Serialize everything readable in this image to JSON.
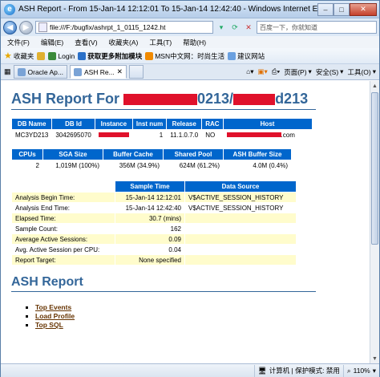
{
  "window": {
    "title": "ASH Report - From 15-Jan-14 12:12:01 To 15-Jan-14 12:42:40 - Windows Internet Explorer",
    "min": "–",
    "max": "□",
    "close": "✕"
  },
  "address": {
    "url": "file:///F:/bugfix/ashrpt_1_0115_1242.ht",
    "search_placeholder": "百度一下，你就知道"
  },
  "menu": [
    "文件(F)",
    "编辑(E)",
    "查看(V)",
    "收藏夹(A)",
    "工具(T)",
    "帮助(H)"
  ],
  "favorites": {
    "label": "收藏夹",
    "items": [
      "Login",
      "获取更多附加模块",
      "MSN中文网：时尚生活",
      "建议网站"
    ]
  },
  "tabs": [
    {
      "label": "Oracle Ap..."
    },
    {
      "label": "ASH Re..."
    }
  ],
  "commands": [
    "页面(P)",
    "安全(S)",
    "工具(O)"
  ],
  "report": {
    "title_prefix": "ASH Report For",
    "title_mid": "0213/",
    "title_suffix": "d213",
    "db_table": {
      "headers": [
        "DB Name",
        "DB Id",
        "Instance",
        "Inst num",
        "Release",
        "RAC",
        "Host"
      ],
      "row": {
        "db_name": "MC3YD213",
        "db_id": "3042695070",
        "inst_num": "1",
        "release": "11.1.0.7.0",
        "rac": "NO",
        "host_suffix": ".com"
      }
    },
    "cpu_table": {
      "headers": [
        "CPUs",
        "SGA Size",
        "Buffer Cache",
        "Shared Pool",
        "ASH Buffer Size"
      ],
      "row": [
        "2",
        "1,019M (100%)",
        "356M (34.9%)",
        "624M (61.2%)",
        "4.0M (0.4%)"
      ]
    },
    "analysis_table": {
      "headers": [
        "",
        "Sample Time",
        "Data Source"
      ],
      "rows": [
        [
          "Analysis Begin Time:",
          "15-Jan-14 12:12:01",
          "V$ACTIVE_SESSION_HISTORY"
        ],
        [
          "Analysis End Time:",
          "15-Jan-14 12:42:40",
          "V$ACTIVE_SESSION_HISTORY"
        ],
        [
          "Elapsed Time:",
          "30.7 (mins)",
          ""
        ],
        [
          "Sample Count:",
          "162",
          ""
        ],
        [
          "Average Active Sessions:",
          "0.09",
          ""
        ],
        [
          "Avg. Active Session per CPU:",
          "0.04",
          ""
        ],
        [
          "Report Target:",
          "None specified",
          ""
        ]
      ]
    },
    "section_title": "ASH Report",
    "links": [
      "Top Events",
      "Load Profile",
      "Top SQL"
    ]
  },
  "status": {
    "zone": "计算机 | 保护模式: 禁用",
    "zoom": "110%"
  },
  "colors": {
    "header_blue": "#0066cc",
    "title_blue": "#336699",
    "alt_row": "#fffccc",
    "redaction": "#e0112b"
  }
}
